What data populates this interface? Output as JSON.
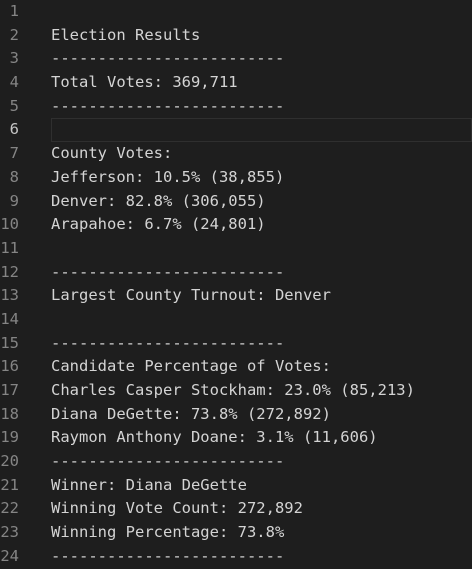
{
  "editor": {
    "current_line": 6,
    "lines": [
      {
        "num": "1",
        "text": ""
      },
      {
        "num": "2",
        "text": "Election Results"
      },
      {
        "num": "3",
        "text": "-------------------------"
      },
      {
        "num": "4",
        "text": "Total Votes: 369,711"
      },
      {
        "num": "5",
        "text": "-------------------------"
      },
      {
        "num": "6",
        "text": ""
      },
      {
        "num": "7",
        "text": "County Votes:"
      },
      {
        "num": "8",
        "text": "Jefferson: 10.5% (38,855)"
      },
      {
        "num": "9",
        "text": "Denver: 82.8% (306,055)"
      },
      {
        "num": "10",
        "text": "Arapahoe: 6.7% (24,801)"
      },
      {
        "num": "11",
        "text": ""
      },
      {
        "num": "12",
        "text": "-------------------------"
      },
      {
        "num": "13",
        "text": "Largest County Turnout: Denver"
      },
      {
        "num": "14",
        "text": ""
      },
      {
        "num": "15",
        "text": "-------------------------"
      },
      {
        "num": "16",
        "text": "Candidate Percentage of Votes:"
      },
      {
        "num": "17",
        "text": "Charles Casper Stockham: 23.0% (85,213)"
      },
      {
        "num": "18",
        "text": "Diana DeGette: 73.8% (272,892)"
      },
      {
        "num": "19",
        "text": "Raymon Anthony Doane: 3.1% (11,606)"
      },
      {
        "num": "20",
        "text": "-------------------------"
      },
      {
        "num": "21",
        "text": "Winner: Diana DeGette"
      },
      {
        "num": "22",
        "text": "Winning Vote Count: 272,892"
      },
      {
        "num": "23",
        "text": "Winning Percentage: 73.8%"
      },
      {
        "num": "24",
        "text": "-------------------------"
      }
    ]
  }
}
